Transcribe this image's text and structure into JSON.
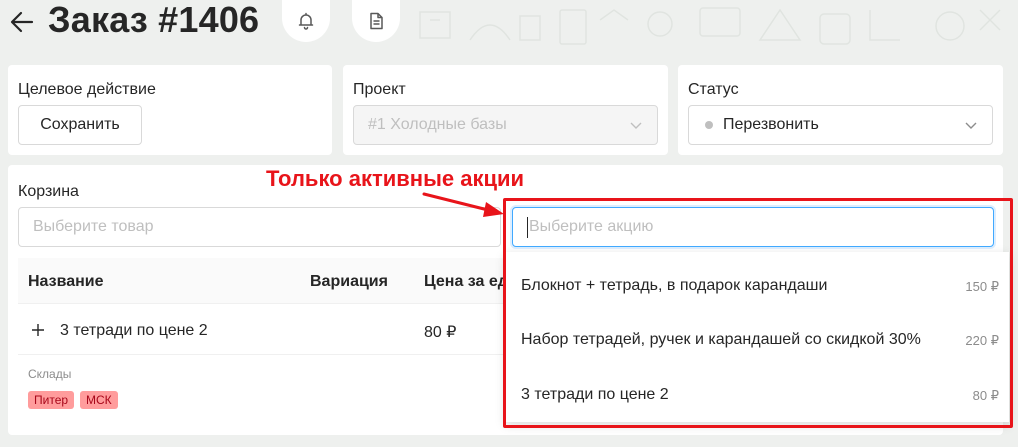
{
  "header": {
    "title": "Заказ #1406",
    "back_icon": "arrow-left-icon",
    "bell_icon": "bell-icon",
    "doc_icon": "document-icon"
  },
  "target_action": {
    "label": "Целевое действие",
    "button": "Сохранить"
  },
  "project": {
    "label": "Проект",
    "value": "#1 Холодные базы"
  },
  "status": {
    "label": "Статус",
    "value": "Перезвонить"
  },
  "cart": {
    "label": "Корзина",
    "product_placeholder": "Выберите товар",
    "promo_placeholder": "Выберите акцию",
    "columns": [
      "Название",
      "Вариация",
      "Цена за ед"
    ],
    "rows": [
      {
        "name": "3 тетради по цене 2",
        "variation": "",
        "price": "80 ₽"
      }
    ],
    "warehouses_label": "Склады",
    "warehouses": [
      "Питер",
      "МСК"
    ]
  },
  "promo_options": [
    {
      "label": "Блокнот + тетрадь, в подарок карандаши",
      "price": "150 ₽"
    },
    {
      "label": "Набор тетрадей, ручек и карандашей со скидкой 30%",
      "price": "220 ₽"
    },
    {
      "label": "3 тетради по цене 2",
      "price": "80 ₽"
    }
  ],
  "annotation": {
    "text": "Только активные акции"
  },
  "colors": {
    "annotation": "#e8141a",
    "tag_bg": "#ff9c9c",
    "focus": "#40a9ff"
  }
}
